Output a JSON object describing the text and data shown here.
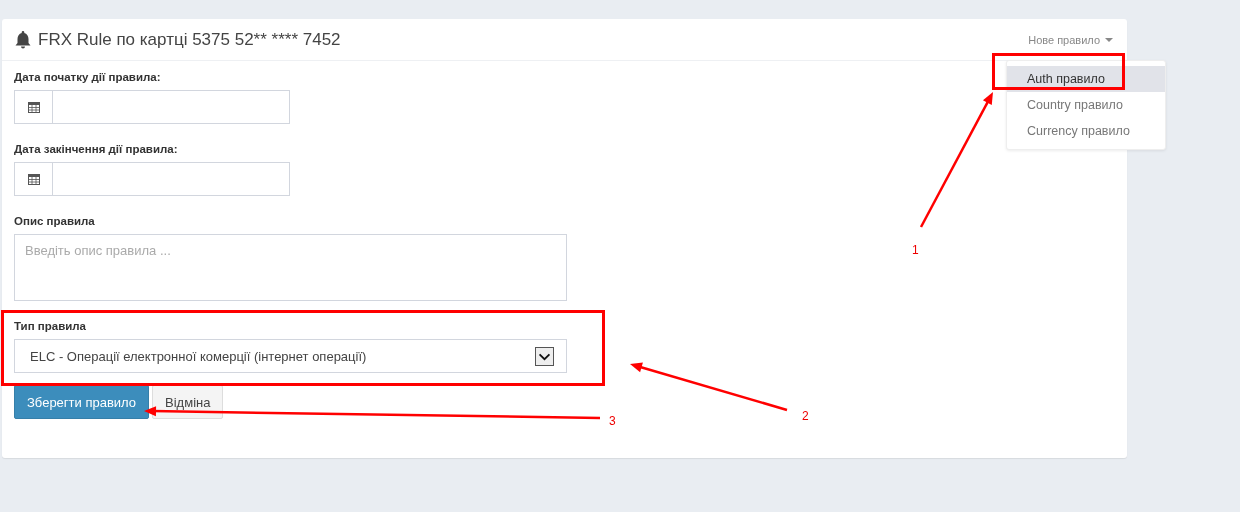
{
  "panel": {
    "title": "FRX Rule по картці 5375 52** **** 7452"
  },
  "new_rule_menu": {
    "label": "Нове правило",
    "expanded": true,
    "items": [
      {
        "label": "Auth правило",
        "selected": true
      },
      {
        "label": "Country правило",
        "selected": false
      },
      {
        "label": "Currency правило",
        "selected": false
      }
    ]
  },
  "form": {
    "start_date": {
      "label": "Дата початку дії правила:"
    },
    "end_date": {
      "label": "Дата закінчення дії правила:"
    },
    "description": {
      "label": "Опис правила",
      "placeholder": "Введіть опис правила ..."
    },
    "rule_type": {
      "label": "Тип правила",
      "value": "ELC - Операції електронної комерції (інтернет операції)"
    },
    "buttons": [
      {
        "label": "Зберегти правило",
        "kind": "primary"
      },
      {
        "label": "Відміна",
        "kind": "default"
      }
    ]
  },
  "annotations": [
    {
      "label": "1"
    },
    {
      "label": "2"
    },
    {
      "label": "3"
    }
  ]
}
